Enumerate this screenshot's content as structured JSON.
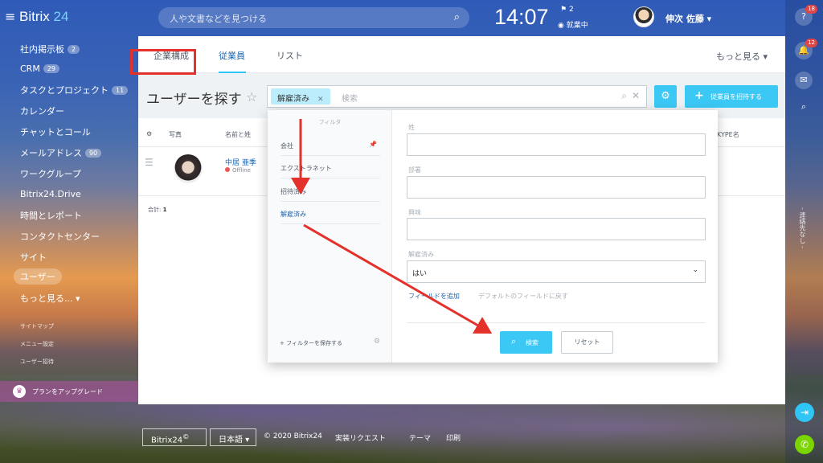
{
  "header": {
    "logo_main": "Bitrix",
    "logo_num": " 24",
    "search_placeholder": "人や文書などを見つける",
    "time": "14:07",
    "flag_count": "2",
    "work_status": "就業中",
    "user_name": "伸次 佐藤"
  },
  "sidebar": {
    "items": [
      {
        "label": "社内掲示板",
        "badge": "2"
      },
      {
        "label": "CRM",
        "badge": "29"
      },
      {
        "label": "タスクとプロジェクト",
        "badge": "11"
      },
      {
        "label": "カレンダー"
      },
      {
        "label": "チャットとコール"
      },
      {
        "label": "メールアドレス",
        "badge": "90"
      },
      {
        "label": "ワークグループ"
      },
      {
        "label": "Bitrix24.Drive"
      },
      {
        "label": "時間とレポート"
      },
      {
        "label": "コンタクトセンター"
      },
      {
        "label": "サイト"
      },
      {
        "label": "ユーザー"
      },
      {
        "label": "もっと見る..."
      }
    ],
    "small": [
      "サイトマップ",
      "メニュー設定",
      "ユーザー招待"
    ],
    "upgrade": "プランをアップグレード"
  },
  "rightbar": {
    "help_count": "18",
    "notif_count": "12",
    "vertical_text": "- 連絡先なし -"
  },
  "tabs": [
    "企業構成",
    "従業員",
    "リスト"
  ],
  "more": "もっと見る",
  "page_title": "ユーザーを探す",
  "filter": {
    "chip": "解雇済み",
    "placeholder": "検索",
    "invite": "従業員を招待する"
  },
  "table": {
    "headers": [
      "写真",
      "名前と姓",
      "KYPE名"
    ],
    "user_name": "中居 亜季",
    "user_status": "Offline",
    "total_label": "合計:",
    "total_value": "1"
  },
  "popup": {
    "head": "フィルタ",
    "items": [
      "会社",
      "エクストラネット",
      "招待済み",
      "解雇済み"
    ],
    "save": "フィルターを保存する",
    "fields": [
      "姓",
      "部署",
      "興味",
      "解雇済み"
    ],
    "select_value": "はい",
    "add_field": "フィールドを追加",
    "reset_fields": "デフォルトのフィールドに戻す",
    "search_btn": "検索",
    "reset_btn": "リセット"
  },
  "footer": {
    "brand": "Bitrix24",
    "lang": "日本語",
    "copyright": "© 2020 Bitrix24",
    "links": [
      "実装リクエスト",
      "テーマ",
      "印刷"
    ]
  },
  "colors": {
    "accent": "#3bc8f5",
    "link": "#2067b0",
    "annotation": "#e5312b"
  }
}
